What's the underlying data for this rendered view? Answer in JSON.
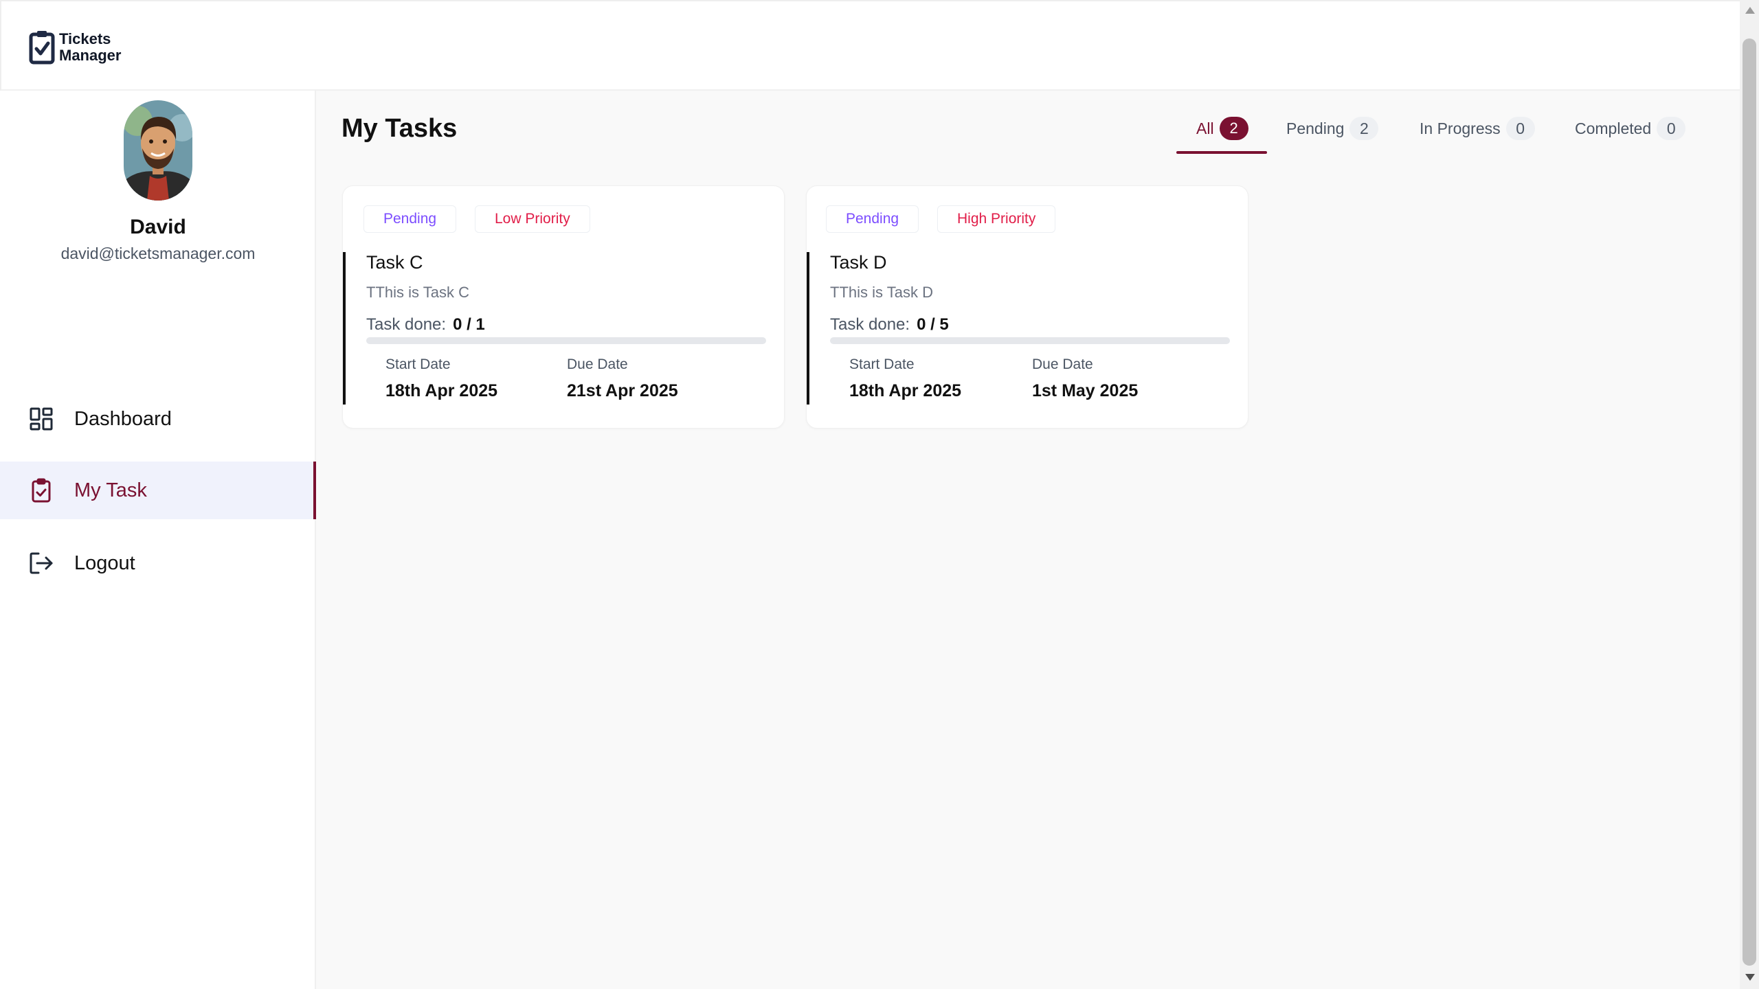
{
  "app": {
    "logo_line1": "Tickets",
    "logo_line2": "Manager"
  },
  "user": {
    "name": "David",
    "email": "david@ticketsmanager.com"
  },
  "sidebar": {
    "items": [
      {
        "label": "Dashboard",
        "icon": "dashboard-grid-icon"
      },
      {
        "label": "My Task",
        "icon": "clipboard-check-icon",
        "active": true
      },
      {
        "label": "Logout",
        "icon": "logout-icon"
      }
    ]
  },
  "main": {
    "title": "My Tasks",
    "tabs": [
      {
        "label": "All",
        "count": "2",
        "active": true
      },
      {
        "label": "Pending",
        "count": "2"
      },
      {
        "label": "In Progress",
        "count": "0"
      },
      {
        "label": "Completed",
        "count": "0"
      }
    ]
  },
  "tasks": [
    {
      "status": "Pending",
      "priority": "Low Priority",
      "title": "Task C",
      "description": "TThis is Task C",
      "done_label": "Task done:",
      "done_value": "0 / 1",
      "progress_fraction": 0,
      "start_label": "Start Date",
      "start_date": "18th Apr 2025",
      "due_label": "Due Date",
      "due_date": "21st Apr 2025"
    },
    {
      "status": "Pending",
      "priority": "High Priority",
      "title": "Task D",
      "description": "TThis is Task D",
      "done_label": "Task done:",
      "done_value": "0 / 5",
      "progress_fraction": 0,
      "start_label": "Start Date",
      "start_date": "18th Apr 2025",
      "due_label": "Due Date",
      "due_date": "1st May 2025"
    }
  ],
  "colors": {
    "accent": "#7a1131",
    "status_text": "#7c4dff",
    "priority_text": "#e11d48"
  }
}
